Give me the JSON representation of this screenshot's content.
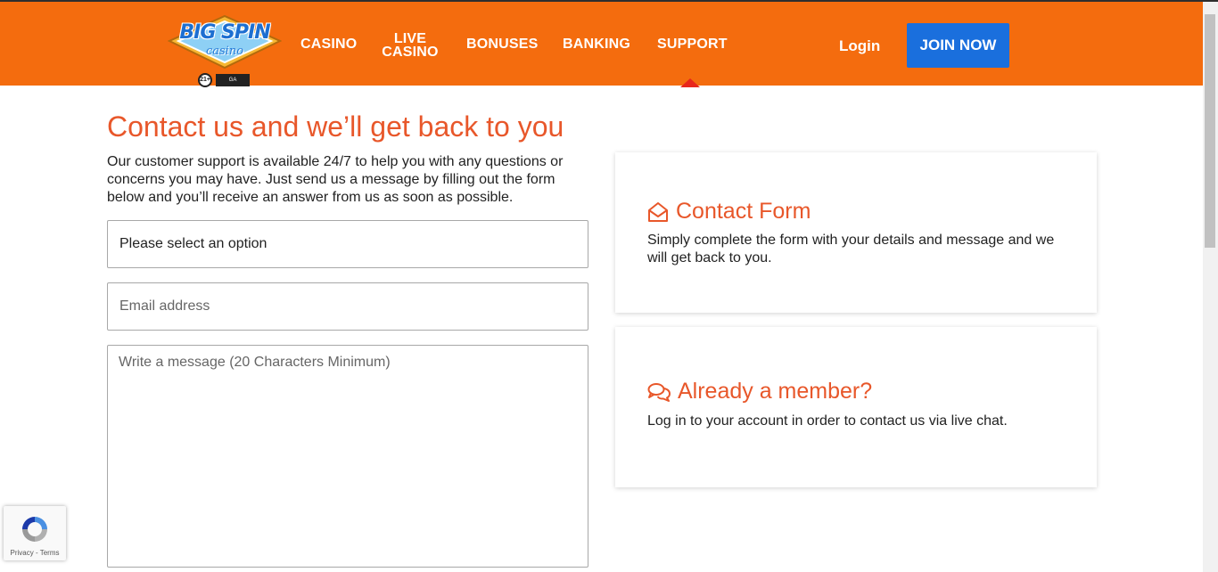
{
  "header": {
    "logo": {
      "line1": "BIG SPIN",
      "line2": "casino",
      "age": "21+",
      "ga": "GAMBLERS ANONYMOUS"
    },
    "nav": [
      {
        "label": "CASINO"
      },
      {
        "label_line1": "LIVE",
        "label_line2": "CASINO"
      },
      {
        "label": "BONUSES"
      },
      {
        "label": "BANKING"
      },
      {
        "label": "SUPPORT",
        "active": true
      }
    ],
    "login_label": "Login",
    "join_label": "JOIN NOW"
  },
  "main": {
    "title": "Contact us and we’ll get back to you",
    "intro": "Our customer support is available 24/7 to help you with any questions or concerns you may have. Just send us a message by filling out the form below and you’ll receive an answer from us as soon as possible.",
    "form": {
      "select_value": "Please select an option",
      "email_placeholder": "Email address",
      "message_placeholder": "Write a message (20 Characters Minimum)"
    }
  },
  "cards": {
    "contact": {
      "title": "Contact Form",
      "text": "Simply complete the form with your details and message and we will get back to you.",
      "icon": "envelope-open-icon"
    },
    "member": {
      "title": "Already a member?",
      "text": "Log in to your account in order to contact us via live chat.",
      "icon": "chat-bubbles-icon"
    }
  },
  "recaptcha": {
    "privacy": "Privacy",
    "sep": " - ",
    "terms": "Terms"
  },
  "colors": {
    "header": "#f46c0e",
    "accent": "#e8572a",
    "join": "#1a6fdd",
    "indicator": "#e8261b"
  }
}
